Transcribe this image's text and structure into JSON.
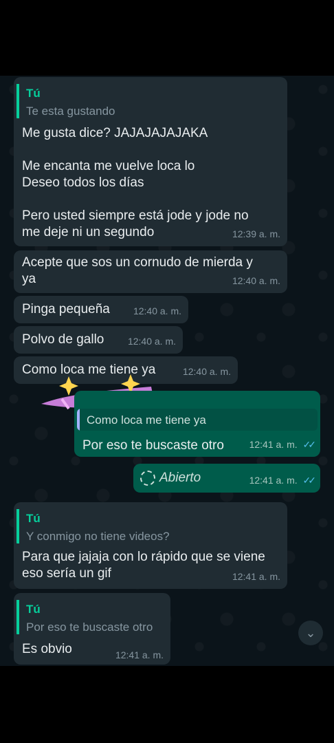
{
  "messages": [
    {
      "sender_label": "Tú",
      "quote": "Te esta gustando",
      "text": "Me gusta dice? JAJAJAJAJAKA\n\nMe encanta me vuelve loca lo\nDeseo todos los días\n\nPero usted siempre está jode y jode no\nme deje ni un segundo",
      "time": "12:39 a. m."
    },
    {
      "text": "Acepte que sos un cornudo de mierda y\nya",
      "time": "12:40 a. m."
    },
    {
      "text": "Pinga pequeña",
      "time": "12:40 a. m."
    },
    {
      "text": "Polvo de gallo",
      "time": "12:40 a. m."
    },
    {
      "text": "Como loca me tiene ya",
      "time": "12:40 a. m."
    },
    {
      "quote": "Como loca me tiene ya",
      "text": "Por eso te buscaste otro",
      "time": "12:41 a. m.",
      "ticks": "✓✓"
    },
    {
      "text": "Abierto",
      "time": "12:41 a. m.",
      "ticks": "✓✓"
    },
    {
      "sender_label": "Tú",
      "quote": "Y conmigo no tiene videos?",
      "text": "Para que jajaja con lo rápido que se viene\neso sería un gif",
      "time": "12:41 a. m."
    },
    {
      "sender_label": "Tú",
      "quote": "Por eso te buscaste otro",
      "text": "Es obvio",
      "time": "12:41 a. m."
    }
  ],
  "scroll_down_icon": "double-chevron-down"
}
